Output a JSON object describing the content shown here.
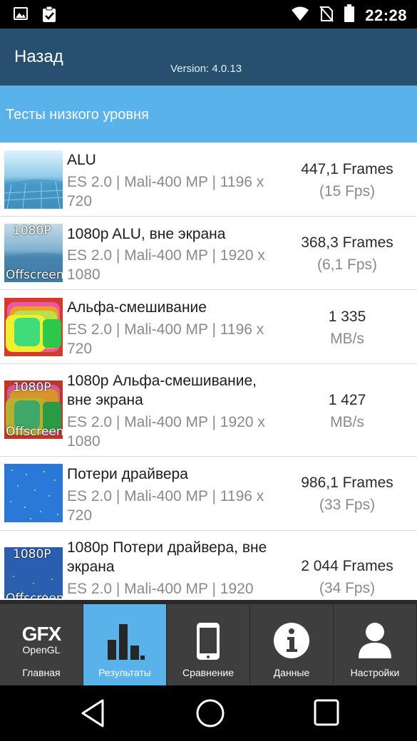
{
  "status_bar": {
    "time": "22:28",
    "icons": [
      "image-icon",
      "clipboard-check-icon",
      "wifi-icon",
      "no-sim-icon",
      "battery-icon"
    ]
  },
  "app_bar": {
    "back_label": "Назад",
    "version": "Version: 4.0.13"
  },
  "section": {
    "title": "Тесты низкого уровня"
  },
  "tests": [
    {
      "title": "ALU",
      "subtitle": "ES 2.0 | Mali-400 MP | 1196 x 720",
      "value": "447,1 Frames",
      "unit": "(15 Fps)",
      "thumb": "alu",
      "badge_top": "",
      "badge_bottom": ""
    },
    {
      "title": "1080p ALU, вне экрана",
      "subtitle": "ES 2.0 | Mali-400 MP | 1920 x 1080",
      "value": "368,3 Frames",
      "unit": "(6,1 Fps)",
      "thumb": "alu",
      "badge_top": "1080P",
      "badge_bottom": "Offscreen"
    },
    {
      "title": "Альфа-смешивание",
      "subtitle": "ES 2.0 | Mali-400 MP | 1196 x 720",
      "value": "1 335",
      "unit": "MB/s",
      "thumb": "blend",
      "badge_top": "",
      "badge_bottom": ""
    },
    {
      "title": "1080p Альфа-смешивание, вне экрана",
      "subtitle": "ES 2.0 | Mali-400 MP | 1920 x 1080",
      "value": "1 427",
      "unit": "MB/s",
      "thumb": "blend",
      "badge_top": "1080P",
      "badge_bottom": "Offscreen"
    },
    {
      "title": "Потери драйвера",
      "subtitle": "ES 2.0 | Mali-400 MP | 1196 x 720",
      "value": "986,1 Frames",
      "unit": "(33 Fps)",
      "thumb": "driver",
      "badge_top": "",
      "badge_bottom": ""
    },
    {
      "title": "1080p Потери драйвера, вне экрана",
      "subtitle": "ES 2.0 | Mali-400 MP | 1920",
      "value": "2 044 Frames",
      "unit": "(34 Fps)",
      "thumb": "driver",
      "badge_top": "1080P",
      "badge_bottom": "Offscreen"
    }
  ],
  "tabs": [
    {
      "label": "Главная",
      "icon": "gfx-opengl-logo",
      "logo_big": "GFX",
      "logo_small": "OpenGL"
    },
    {
      "label": "Результаты",
      "icon": "bar-chart-icon",
      "active": true
    },
    {
      "label": "Сравнение",
      "icon": "phone-icon"
    },
    {
      "label": "Данные",
      "icon": "info-icon"
    },
    {
      "label": "Настройки",
      "icon": "user-icon"
    }
  ],
  "nav": [
    "back-icon",
    "home-icon",
    "recents-icon"
  ],
  "colors": {
    "app_bar": "#26506e",
    "section": "#59b2ea",
    "tab_active": "#59b2ea",
    "tab_bg": "#3e3e3e"
  }
}
